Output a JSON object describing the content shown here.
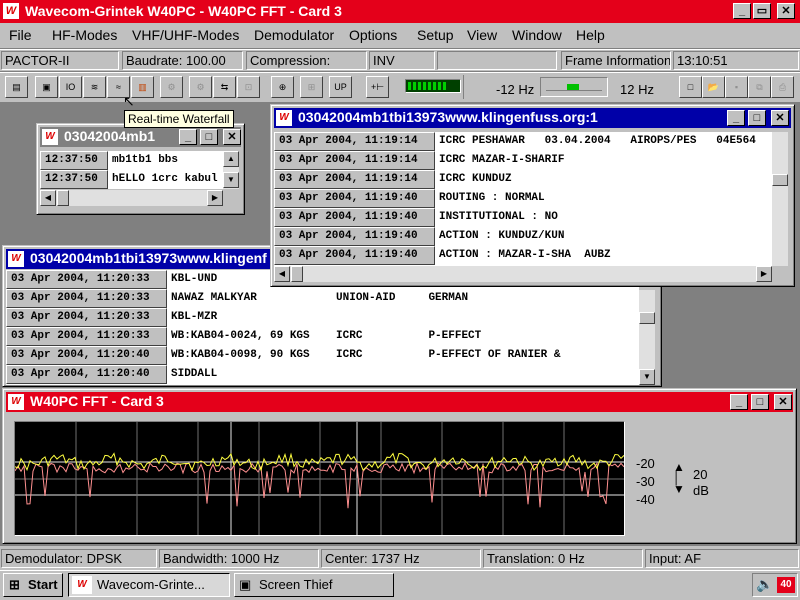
{
  "app": {
    "title": "Wavecom-Grintek W40PC - W40PC FFT - Card 3",
    "logo_text": "W",
    "caption_buttons": [
      "_",
      "▭",
      "✕"
    ]
  },
  "menu": [
    "File",
    "HF-Modes",
    "VHF/UHF-Modes",
    "Demodulator",
    "Options",
    "Setup",
    "View",
    "Window",
    "Help"
  ],
  "info_bar": {
    "mode": "PACTOR-II",
    "baudrate": "Baudrate: 100.00",
    "compression": "Compression:",
    "inv": "INV",
    "frame_info": "Frame Information:",
    "time": "13:10:51"
  },
  "toolbar": {
    "offset_left": "-12 Hz",
    "offset_right": "12 Hz"
  },
  "tooltip": "Real-time Waterfall",
  "windows": {
    "small": {
      "title": "03042004mb1",
      "rows": [
        {
          "time": "12:37:50",
          "text": "mb1tb1 bbs"
        },
        {
          "time": "12:37:50",
          "text": "hELLO 1crc kabul"
        }
      ]
    },
    "right": {
      "title": "03042004mb1tbi13973www.klingenfuss.org:1",
      "rows": [
        {
          "time": "03 Apr 2004, 11:19:14",
          "text": "ICRC PESHAWAR   03.04.2004   AIROPS/PES   04E564"
        },
        {
          "time": "03 Apr 2004, 11:19:14",
          "text": "ICRC MAZAR-I-SHARIF"
        },
        {
          "time": "03 Apr 2004, 11:19:14",
          "text": "ICRC KUNDUZ"
        },
        {
          "time": "03 Apr 2004, 11:19:40",
          "text": "ROUTING : NORMAL"
        },
        {
          "time": "03 Apr 2004, 11:19:40",
          "text": "INSTITUTIONAL : NO"
        },
        {
          "time": "03 Apr 2004, 11:19:40",
          "text": "ACTION : KUNDUZ/KUN"
        },
        {
          "time": "03 Apr 2004, 11:19:40",
          "text": "ACTION : MAZAR-I-SHA  AUBZ"
        }
      ]
    },
    "left": {
      "title": "03042004mb1tbi13973www.klingenf",
      "rows": [
        {
          "time": "03 Apr 2004, 11:20:33",
          "text": "KBL-UND"
        },
        {
          "time": "03 Apr 2004, 11:20:33",
          "text": "NAWAZ MALKYAR            UNION-AID     GERMAN"
        },
        {
          "time": "03 Apr 2004, 11:20:33",
          "text": "KBL-MZR"
        },
        {
          "time": "03 Apr 2004, 11:20:33",
          "text": "WB:KAB04-0024, 69 KGS    ICRC          P-EFFECT"
        },
        {
          "time": "03 Apr 2004, 11:20:40",
          "text": "WB:KAB04-0098, 90 KGS    ICRC          P-EFFECT OF RANIER &"
        },
        {
          "time": "03 Apr 2004, 11:20:40",
          "text": "SIDDALL"
        }
      ]
    },
    "fft": {
      "title": "W40PC FFT  - Card 3",
      "scale": [
        "-20",
        "-30",
        "-40"
      ],
      "range_value": "20",
      "range_unit": "dB"
    }
  },
  "status_bar": {
    "demodulator": "Demodulator: DPSK",
    "bandwidth": "Bandwidth: 1000 Hz",
    "center": "Center: 1737 Hz",
    "translation": "Translation: 0 Hz",
    "input": "Input: AF"
  },
  "taskbar": {
    "start": "Start",
    "tasks": [
      "Wavecom-Grinte...",
      "Screen Thief"
    ],
    "tray_text": "40"
  },
  "colors": {
    "title_red": "#e4001a",
    "active_blue": "#0000a8",
    "fft_yellow": "#ffff40",
    "fft_pink": "#ff9090"
  }
}
